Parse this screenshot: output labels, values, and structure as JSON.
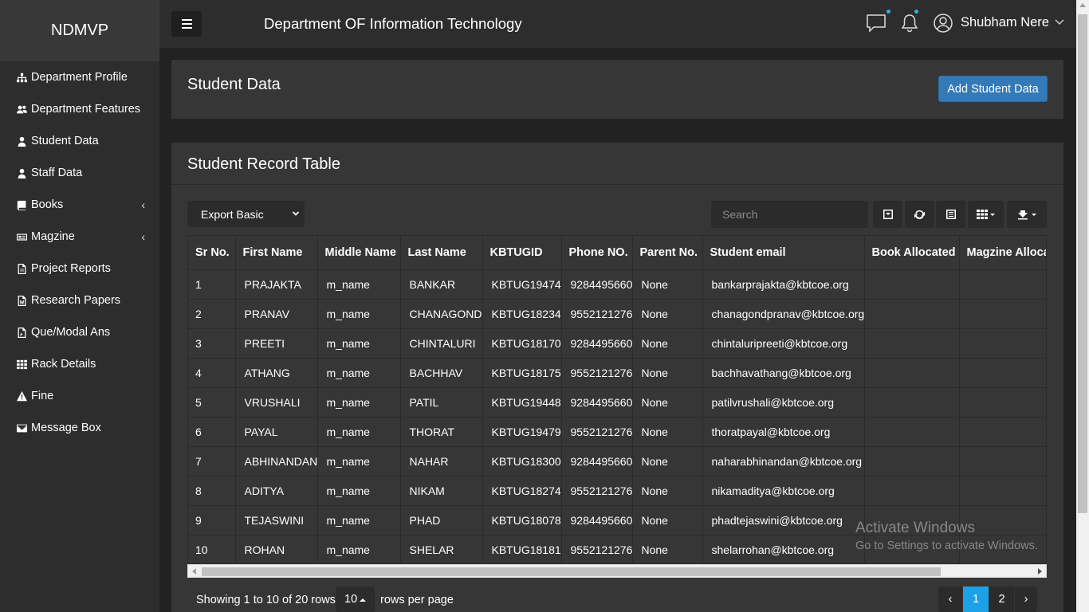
{
  "brand": "NDMVP",
  "header": {
    "title": "Department OF Information Technology",
    "user_name": "Shubham Nere"
  },
  "sidebar": {
    "items": [
      {
        "label": "Department Profile",
        "icon": "sitemap-icon"
      },
      {
        "label": "Department Features",
        "icon": "users-icon"
      },
      {
        "label": "Student Data",
        "icon": "user-icon"
      },
      {
        "label": "Staff Data",
        "icon": "user-icon"
      },
      {
        "label": "Books",
        "icon": "book-icon"
      },
      {
        "label": "Magzine",
        "icon": "newspaper-icon"
      },
      {
        "label": "Project Reports",
        "icon": "file-icon"
      },
      {
        "label": "Research Papers",
        "icon": "word-file-icon"
      },
      {
        "label": "Que/Modal Ans",
        "icon": "pdf-file-icon"
      },
      {
        "label": "Rack Details",
        "icon": "grid-icon"
      },
      {
        "label": "Fine",
        "icon": "warning-icon"
      },
      {
        "label": "Message Box",
        "icon": "envelope-icon"
      }
    ]
  },
  "student_panel": {
    "title": "Student Data",
    "add_button": "Add Student Data"
  },
  "record_table": {
    "title": "Student Record Table",
    "export_select": "Export Basic",
    "search_placeholder": "Search",
    "columns": [
      "Sr No.",
      "First Name",
      "Middle Name",
      "Last Name",
      "KBTUGID",
      "Phone NO.",
      "Parent No.",
      "Student email",
      "Book Allocated",
      "Magzine Allocated"
    ],
    "rows": [
      {
        "sr": "1",
        "first": "PRAJAKTA",
        "middle": "m_name",
        "last": "BANKAR",
        "kbt": "KBTUG19474",
        "phone": "9284495660",
        "parent": "None",
        "email": "bankarprajakta@kbtcoe.org",
        "book": "",
        "mag": ""
      },
      {
        "sr": "2",
        "first": "PRANAV",
        "middle": "m_name",
        "last": "CHANAGOND",
        "kbt": "KBTUG18234",
        "phone": "9552121276",
        "parent": "None",
        "email": "chanagondpranav@kbtcoe.org",
        "book": "",
        "mag": ""
      },
      {
        "sr": "3",
        "first": "PREETI",
        "middle": "m_name",
        "last": "CHINTALURI",
        "kbt": "KBTUG18170",
        "phone": "9284495660",
        "parent": "None",
        "email": "chintaluripreeti@kbtcoe.org",
        "book": "",
        "mag": ""
      },
      {
        "sr": "4",
        "first": "ATHANG",
        "middle": "m_name",
        "last": "BACHHAV",
        "kbt": "KBTUG18175",
        "phone": "9552121276",
        "parent": "None",
        "email": "bachhavathang@kbtcoe.org",
        "book": "",
        "mag": ""
      },
      {
        "sr": "5",
        "first": "VRUSHALI",
        "middle": "m_name",
        "last": "PATIL",
        "kbt": "KBTUG19448",
        "phone": "9284495660",
        "parent": "None",
        "email": "patilvrushali@kbtcoe.org",
        "book": "",
        "mag": ""
      },
      {
        "sr": "6",
        "first": "PAYAL",
        "middle": "m_name",
        "last": "THORAT",
        "kbt": "KBTUG19479",
        "phone": "9552121276",
        "parent": "None",
        "email": "thoratpayal@kbtcoe.org",
        "book": "",
        "mag": ""
      },
      {
        "sr": "7",
        "first": "ABHINANDAN",
        "middle": "m_name",
        "last": "NAHAR",
        "kbt": "KBTUG18300",
        "phone": "9284495660",
        "parent": "None",
        "email": "naharabhinandan@kbtcoe.org",
        "book": "",
        "mag": ""
      },
      {
        "sr": "8",
        "first": "ADITYA",
        "middle": "m_name",
        "last": "NIKAM",
        "kbt": "KBTUG18274",
        "phone": "9552121276",
        "parent": "None",
        "email": "nikamaditya@kbtcoe.org",
        "book": "",
        "mag": ""
      },
      {
        "sr": "9",
        "first": "TEJASWINI",
        "middle": "m_name",
        "last": "PHAD",
        "kbt": "KBTUG18078",
        "phone": "9284495660",
        "parent": "None",
        "email": "phadtejaswini@kbtcoe.org",
        "book": "",
        "mag": ""
      },
      {
        "sr": "10",
        "first": "ROHAN",
        "middle": "m_name",
        "last": "SHELAR",
        "kbt": "KBTUG18181",
        "phone": "9552121276",
        "parent": "None",
        "email": "shelarrohan@kbtcoe.org",
        "book": "",
        "mag": ""
      }
    ],
    "footer": {
      "showing": "Showing 1 to 10 of 20 rows",
      "rows_per_page_value": "10",
      "rows_per_page_label": "rows per page"
    },
    "pagination": {
      "prev": "‹",
      "pages": [
        "1",
        "2"
      ],
      "next": "›",
      "active": "1"
    }
  },
  "watermark": {
    "line1": "Activate Windows",
    "line2": "Go to Settings to activate Windows."
  },
  "colors": {
    "accent": "#337ab7",
    "active_page": "#1da1e6",
    "notification_dot": "#2ab3e8"
  }
}
